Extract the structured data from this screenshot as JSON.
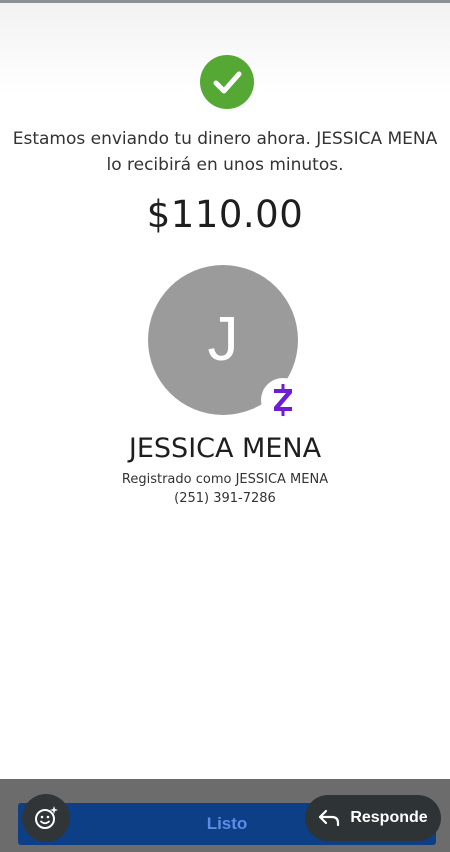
{
  "icons": {
    "success": "checkmark-icon",
    "zelle": "zelle-logo-icon",
    "emoji": "emoji-sparkle-icon",
    "reply": "reply-arrow-icon"
  },
  "colors": {
    "success_green": "#56a834",
    "zelle_purple": "#6d1ed4",
    "button_blue": "#0d3f87",
    "avatar_gray": "#9b9b9b"
  },
  "confirmation": {
    "message_line1": "Estamos enviando tu dinero ahora. JESSICA MENA",
    "message_line2": "lo recibirá en unos minutos.",
    "amount": "$110.00"
  },
  "recipient": {
    "initial": "J",
    "name": "JESSICA MENA",
    "registered_as": "Registrado como JESSICA MENA",
    "phone": "(251) 391-7286"
  },
  "footer": {
    "done_label": "Listo",
    "reply_label": "Responde"
  }
}
